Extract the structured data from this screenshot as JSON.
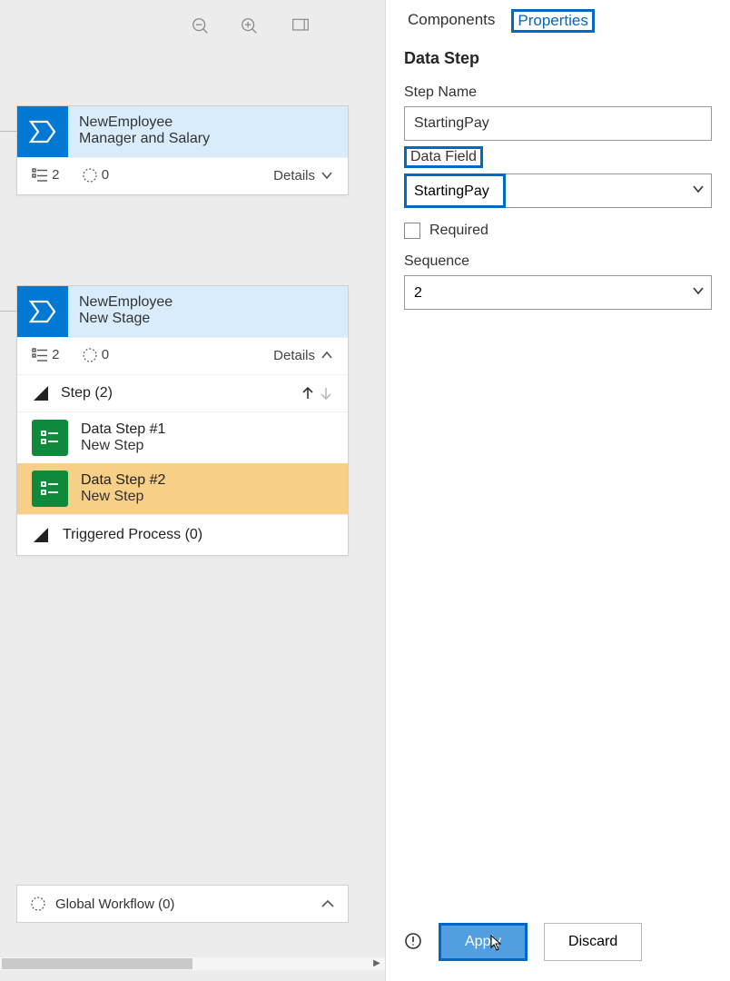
{
  "toolbar": {
    "zoom_out_icon": "zoom-out",
    "zoom_in_icon": "zoom-in",
    "fit_icon": "fit"
  },
  "stages": [
    {
      "title": "NewEmployee",
      "subtitle": "Manager and Salary",
      "step_count": "2",
      "badge_count": "0",
      "details_label": "Details",
      "expanded": false
    },
    {
      "title": "NewEmployee",
      "subtitle": "New Stage",
      "step_count": "2",
      "badge_count": "0",
      "details_label": "Details",
      "expanded": true
    }
  ],
  "step_section": {
    "header": "Step (2)",
    "items": [
      {
        "title": "Data Step #1",
        "subtitle": "New Step",
        "selected": false
      },
      {
        "title": "Data Step #2",
        "subtitle": "New Step",
        "selected": true
      }
    ],
    "triggered": "Triggered Process (0)"
  },
  "global_bar": {
    "label": "Global Workflow (0)"
  },
  "tabs": {
    "components": "Components",
    "properties": "Properties"
  },
  "panel": {
    "title": "Data Step",
    "step_name_label": "Step Name",
    "step_name_value": "StartingPay",
    "data_field_label": "Data Field",
    "data_field_value": "StartingPay",
    "required_label": "Required",
    "required_checked": false,
    "sequence_label": "Sequence",
    "sequence_value": "2"
  },
  "footer": {
    "apply": "Apply",
    "discard": "Discard"
  }
}
